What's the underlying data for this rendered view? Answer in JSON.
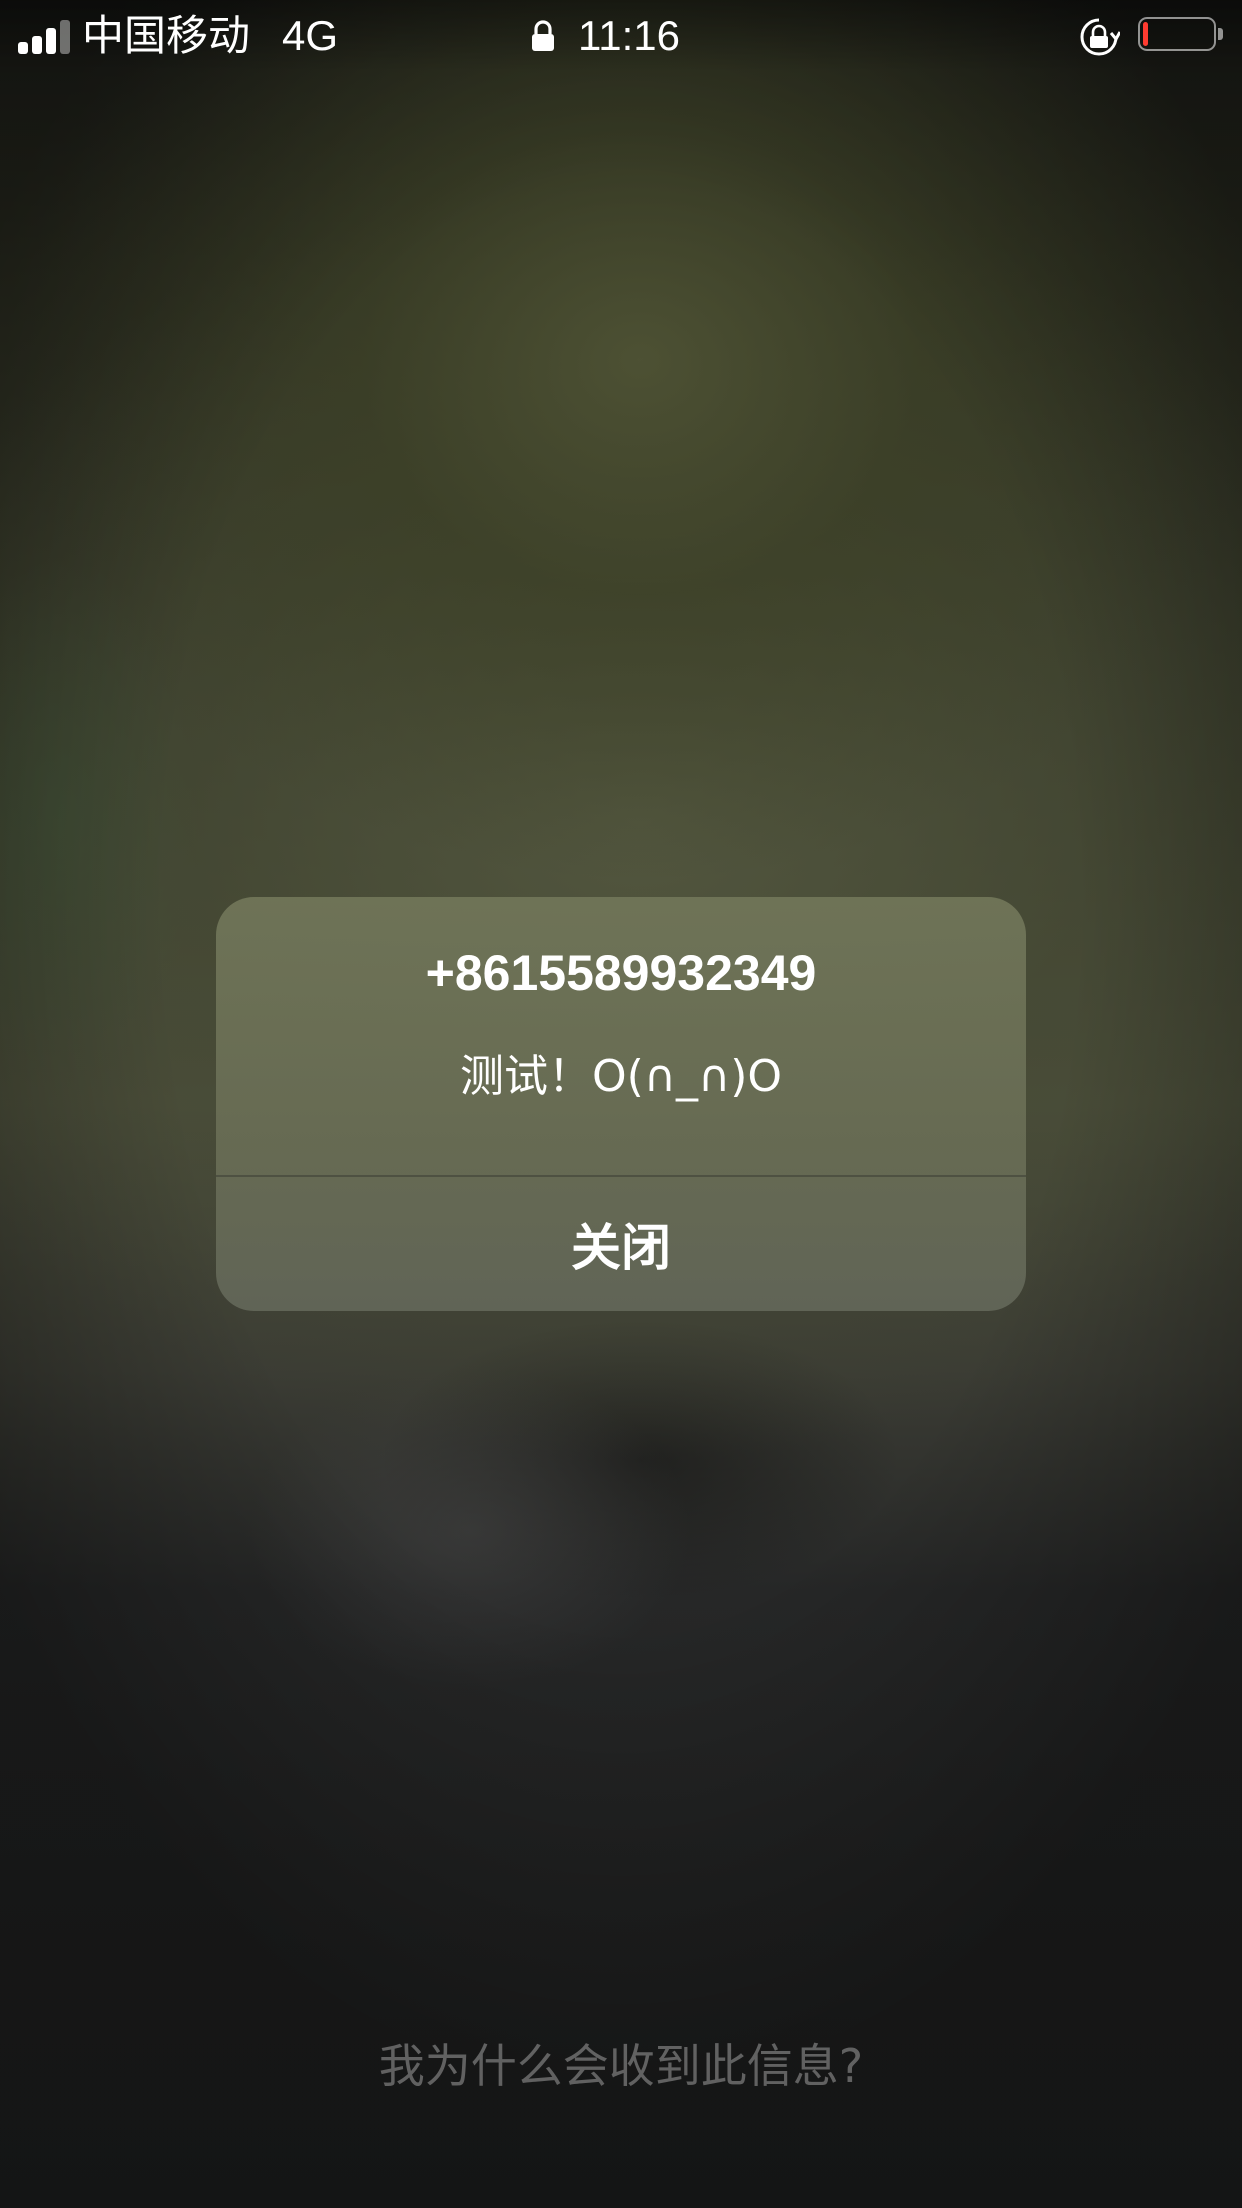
{
  "status_bar": {
    "carrier": "中国移动",
    "network": "4G",
    "time": "11:16",
    "icons": [
      "signal-icon",
      "lock-icon",
      "rotation-lock-icon",
      "battery-icon"
    ],
    "battery_level_fraction": 0.08,
    "battery_color": "#ff3b30"
  },
  "alert": {
    "title": "+8615589932349",
    "message": "测试！O(∩_∩)O",
    "close_label": "关闭"
  },
  "footer": {
    "why_link": "我为什么会收到此信息?"
  }
}
